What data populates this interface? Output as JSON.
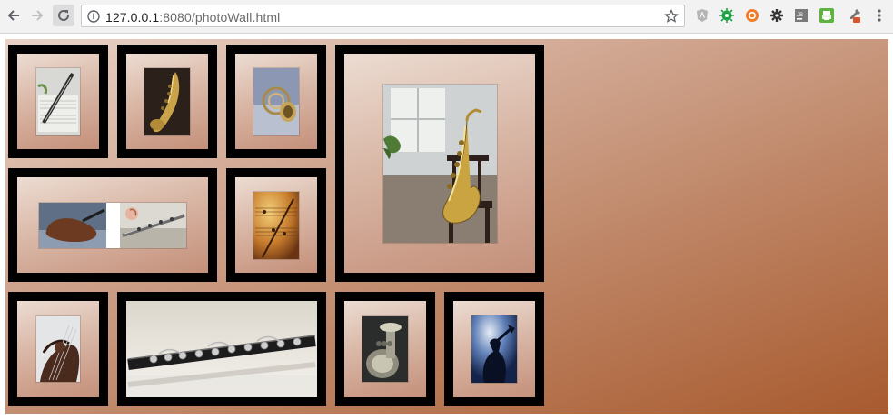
{
  "browser": {
    "url_host": "127.0.0.1",
    "url_path": ":8080/photoWall.html",
    "icons": {
      "back": "back-arrow-icon",
      "forward": "forward-arrow-icon",
      "reload": "reload-icon",
      "info": "info-icon",
      "bookmark": "star-icon",
      "ext1": "angular-extension-icon",
      "ext2": "bug-extension-icon",
      "ext3": "orange-extension-icon",
      "ext4": "gear-extension-icon",
      "ext5": "jb-extension-icon",
      "ext6": "printer-extension-icon",
      "ext7": "eyedropper-extension-icon",
      "menu": "kebab-menu-icon"
    }
  },
  "wall": {
    "colors": {
      "frame": "#000000",
      "wall_start": "#e9d3c7",
      "wall_end": "#a85a2e"
    },
    "photos": [
      {
        "subject": "clarinet-sheet-music"
      },
      {
        "subject": "saxophone"
      },
      {
        "subject": "french-horn"
      },
      {
        "subject": "saxophone-on-chair"
      },
      {
        "subject": "violin-and-flute"
      },
      {
        "subject": "sheet-music"
      },
      {
        "subject": "violin-scroll"
      },
      {
        "subject": "clarinet"
      },
      {
        "subject": "tuba"
      },
      {
        "subject": "trumpet-player"
      }
    ]
  }
}
